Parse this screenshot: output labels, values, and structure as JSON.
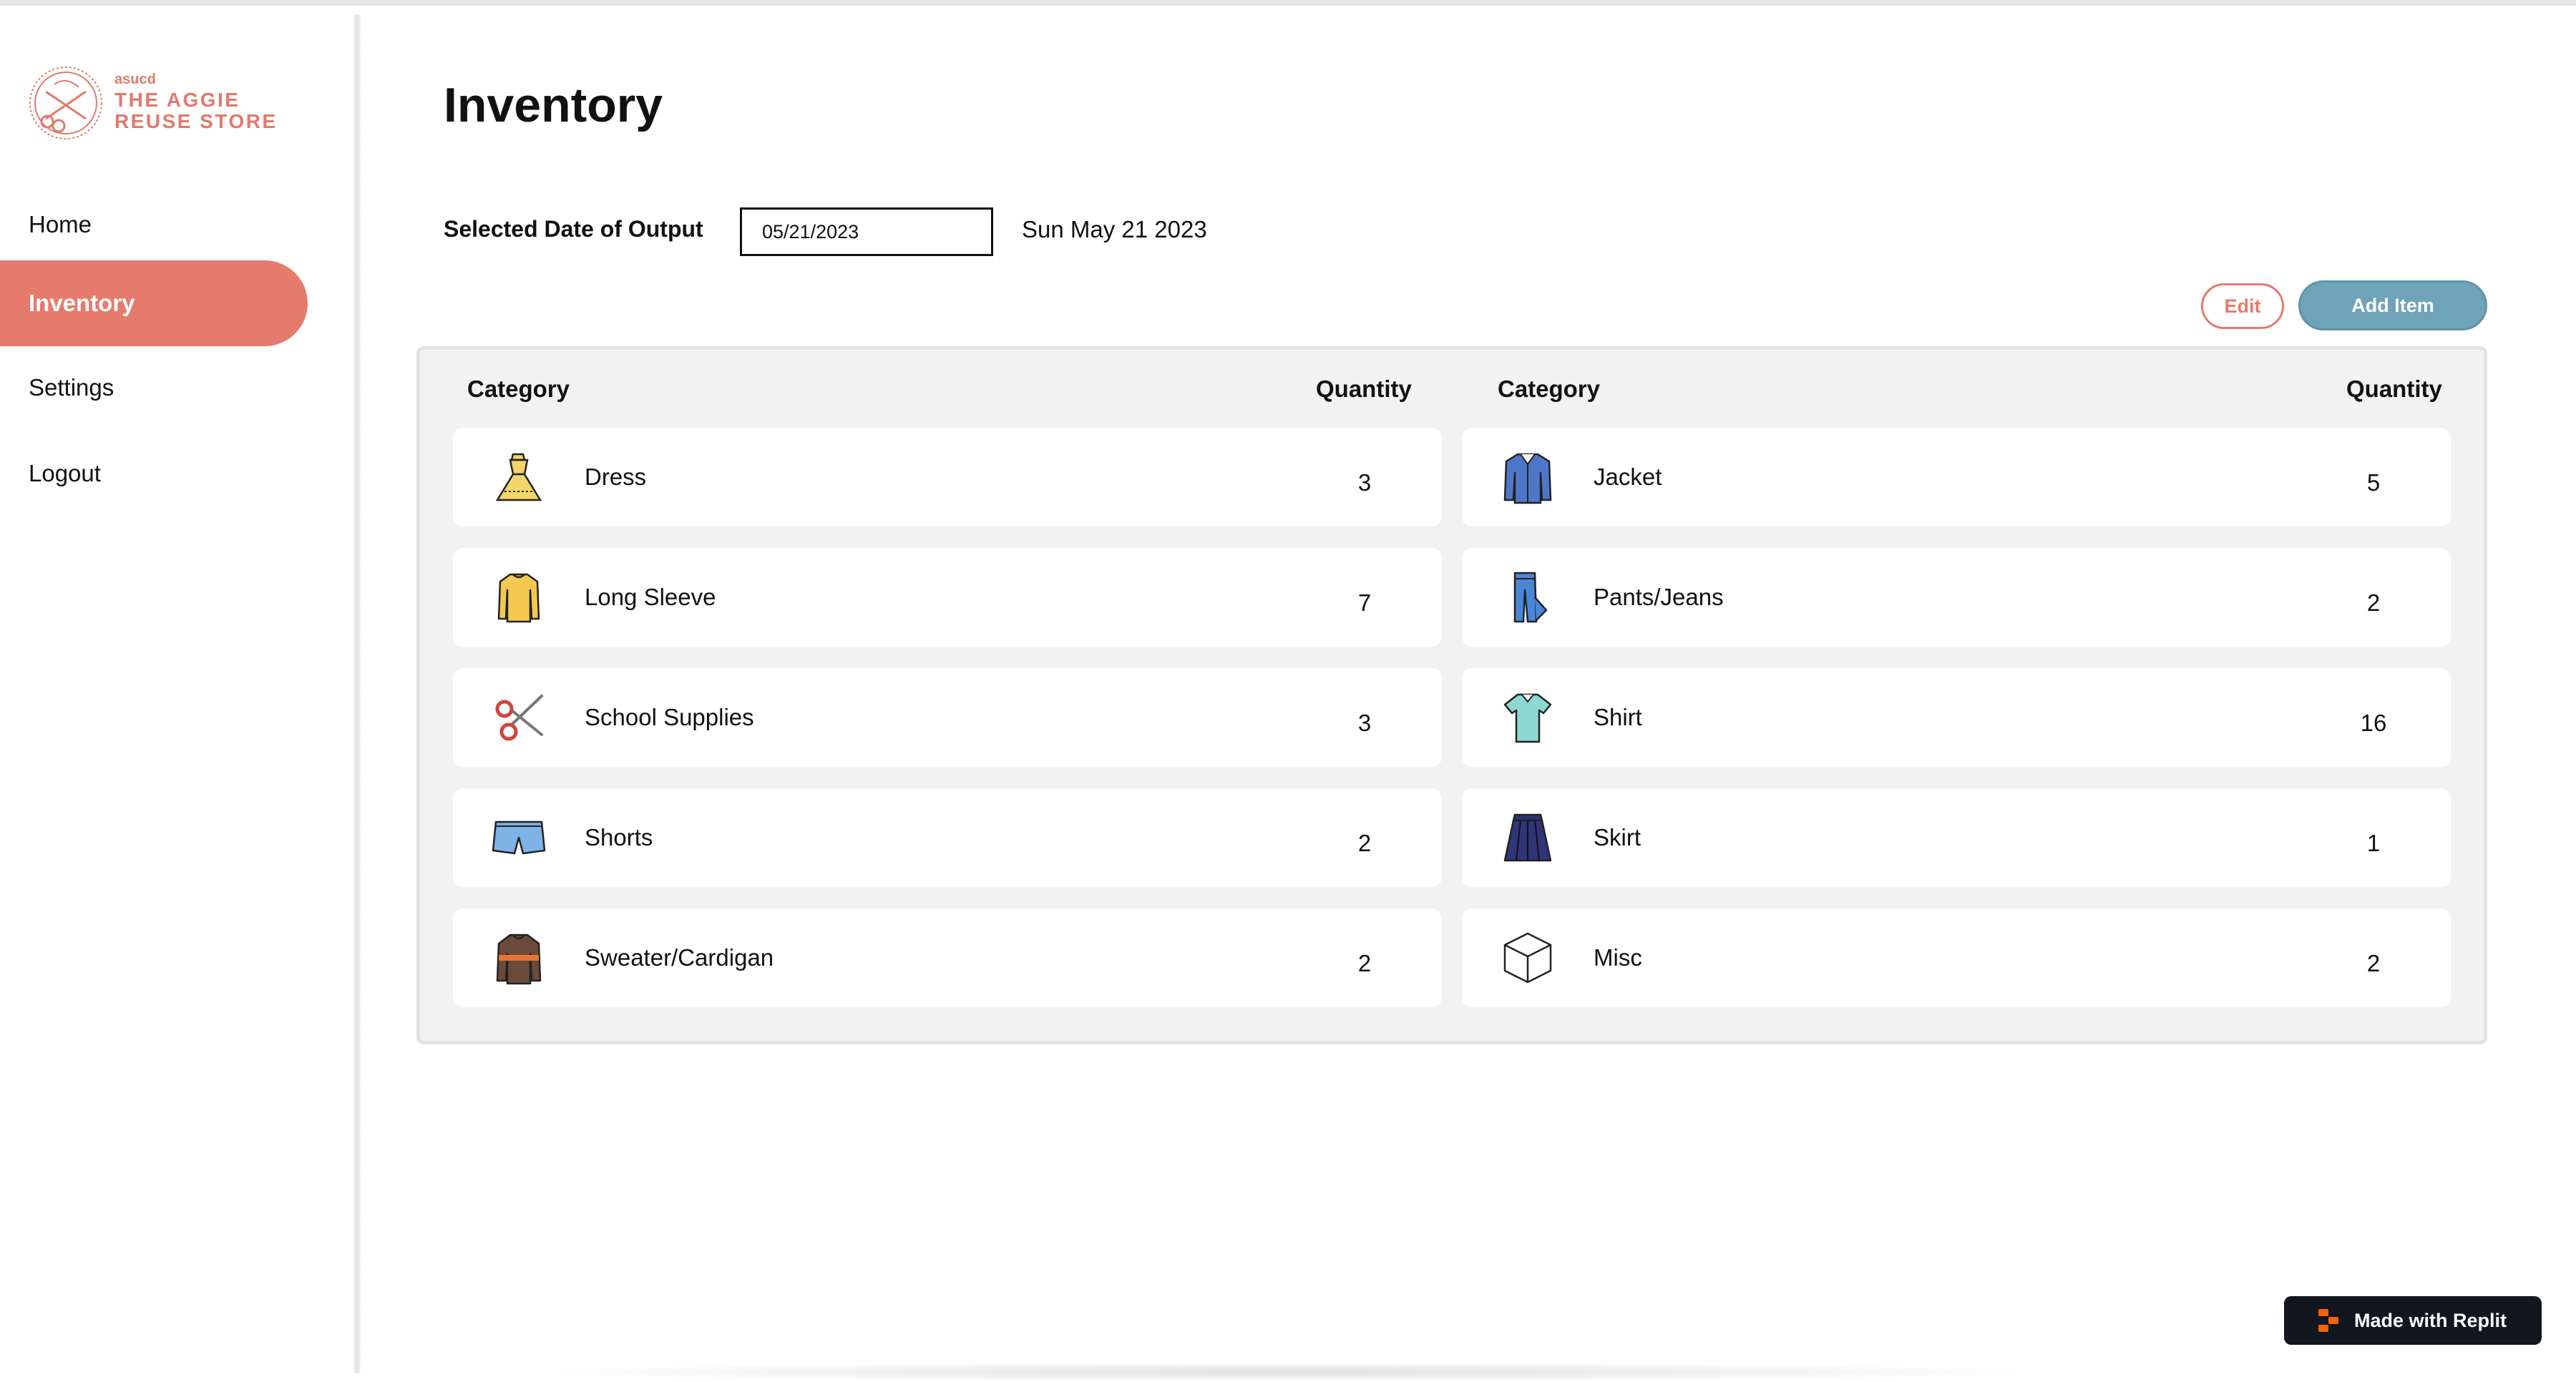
{
  "brand": {
    "small": "asucd",
    "line1": "THE AGGIE",
    "line2": "REUSE STORE",
    "color": "#e07a6d"
  },
  "nav": {
    "items": [
      {
        "label": "Home",
        "active": false
      },
      {
        "label": "Inventory",
        "active": true
      },
      {
        "label": "Settings",
        "active": false
      },
      {
        "label": "Logout",
        "active": false
      }
    ],
    "active_color": "#e47b6d"
  },
  "page": {
    "title": "Inventory",
    "date_label": "Selected Date of Output",
    "date_value": "05/21/2023",
    "date_display": "Sun May 21 2023"
  },
  "toolbar": {
    "edit_label": "Edit",
    "add_label": "Add Item",
    "add_color": "#6fa3b8"
  },
  "table": {
    "headers": {
      "category": "Category",
      "quantity": "Quantity"
    },
    "left": [
      {
        "category": "Dress",
        "quantity": "3",
        "icon": "dress-icon"
      },
      {
        "category": "Long Sleeve",
        "quantity": "7",
        "icon": "long-sleeve-icon"
      },
      {
        "category": "School Supplies",
        "quantity": "3",
        "icon": "scissors-icon"
      },
      {
        "category": "Shorts",
        "quantity": "2",
        "icon": "shorts-icon"
      },
      {
        "category": "Sweater/Cardigan",
        "quantity": "2",
        "icon": "sweater-icon"
      }
    ],
    "right": [
      {
        "category": "Jacket",
        "quantity": "5",
        "icon": "jacket-icon"
      },
      {
        "category": "Pants/Jeans",
        "quantity": "2",
        "icon": "jeans-icon"
      },
      {
        "category": "Shirt",
        "quantity": "16",
        "icon": "shirt-icon"
      },
      {
        "category": "Skirt",
        "quantity": "1",
        "icon": "skirt-icon"
      },
      {
        "category": "Misc",
        "quantity": "2",
        "icon": "box-icon"
      }
    ]
  },
  "badge": {
    "label": "Made with Replit",
    "icon": "replit-icon"
  }
}
